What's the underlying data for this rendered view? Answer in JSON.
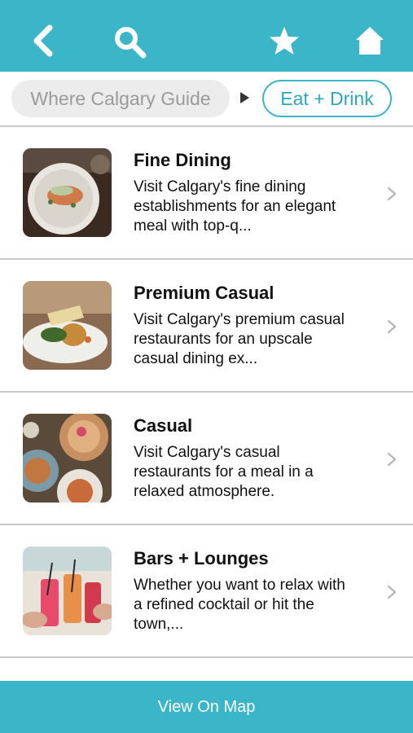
{
  "nav": {
    "back_icon": "chevron-left-icon",
    "search_icon": "search-icon",
    "favorites_icon": "star-icon",
    "home_icon": "home-icon",
    "bar_color": "#3bb6c9"
  },
  "breadcrumb": {
    "root_label": "Where Calgary Guide",
    "current_label": "Eat + Drink"
  },
  "categories": [
    {
      "title": "Fine Dining",
      "description": "Visit Calgary's fine dining establishments for an elegant meal with top-q..."
    },
    {
      "title": "Premium Casual",
      "description": "Visit Calgary's premium casual restaurants for an upscale casual dining ex..."
    },
    {
      "title": "Casual",
      "description": "Visit Calgary's casual restaurants for a meal in a relaxed atmosphere."
    },
    {
      "title": "Bars + Lounges",
      "description": "Whether you want to relax with a refined cocktail or hit the town,..."
    }
  ],
  "footer": {
    "map_label": "View On Map"
  }
}
